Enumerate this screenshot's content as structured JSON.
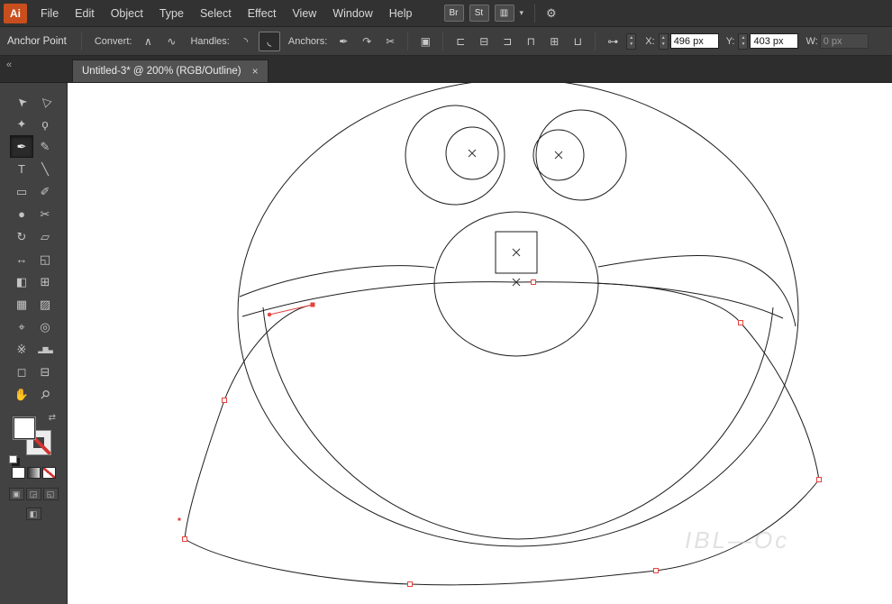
{
  "colors": {
    "selection": "#e5433e",
    "app_icon_bg": "#c94e1d",
    "ui_dark": "#323232",
    "canvas_bg": "#ffffff"
  },
  "menubar": {
    "app_icon": "Ai",
    "menus": [
      "File",
      "Edit",
      "Object",
      "Type",
      "Select",
      "Effect",
      "View",
      "Window",
      "Help"
    ],
    "bridge": "Br",
    "stock": "St",
    "workspace_glyph": "▥",
    "caret_glyph": "▾",
    "live_glyph": "⚙"
  },
  "controlbar": {
    "context": "Anchor Point",
    "convert_label": "Convert:",
    "convert_corner_glyph": "∧",
    "convert_smooth_glyph": "∿",
    "handles_label": "Handles:",
    "handles_show_glyph": "◝",
    "handles_hide_glyph": "◟",
    "anchors_label": "Anchors:",
    "anchors_remove_glyph": "✒",
    "anchors_connect_glyph": "↷",
    "anchors_cut_glyph": "✂",
    "isolate_glyph": "▣",
    "align_left_glyph": "⊏",
    "align_center_glyph": "⊟",
    "align_right_glyph": "⊐",
    "align_top_glyph": "⊓",
    "align_middle_glyph": "⊞",
    "align_bottom_glyph": "⊔",
    "point_glyph": "⊶",
    "stepper_up": "▲",
    "stepper_down": "▼",
    "x_label": "X:",
    "x_value": "496 px",
    "y_label": "Y:",
    "y_value": "403 px",
    "w_label": "W:",
    "w_value": "0 px"
  },
  "tabstrip": {
    "collapse_glyph": "«",
    "tab_title": "Untitled-3* @ 200% (RGB/Outline)",
    "close_glyph": "×"
  },
  "toolbar": {
    "tools": [
      {
        "name": "selection-tool",
        "glyph": "➤"
      },
      {
        "name": "direct-selection-tool",
        "glyph": "▷"
      },
      {
        "name": "magic-wand-tool",
        "glyph": "✦"
      },
      {
        "name": "lasso-tool",
        "glyph": "ϙ"
      },
      {
        "name": "pen-tool",
        "glyph": "✒"
      },
      {
        "name": "pencil-tool",
        "glyph": "✎"
      },
      {
        "name": "type-tool",
        "glyph": "T"
      },
      {
        "name": "line-segment-tool",
        "glyph": "╲"
      },
      {
        "name": "rectangle-tool",
        "glyph": "▭"
      },
      {
        "name": "paintbrush-tool",
        "glyph": "✐"
      },
      {
        "name": "blob-brush-tool",
        "glyph": "●"
      },
      {
        "name": "scissors-tool",
        "glyph": "✂"
      },
      {
        "name": "rotate-tool",
        "glyph": "↻"
      },
      {
        "name": "scale-tool",
        "glyph": "▱"
      },
      {
        "name": "width-tool",
        "glyph": "↔"
      },
      {
        "name": "free-transform-tool",
        "glyph": "◱"
      },
      {
        "name": "shape-builder-tool",
        "glyph": "◧"
      },
      {
        "name": "perspective-grid-tool",
        "glyph": "⊞"
      },
      {
        "name": "mesh-tool",
        "glyph": "▦"
      },
      {
        "name": "gradient-tool",
        "glyph": "▨"
      },
      {
        "name": "eyedropper-tool",
        "glyph": "⌖"
      },
      {
        "name": "blend-tool",
        "glyph": "◎"
      },
      {
        "name": "symbol-sprayer-tool",
        "glyph": "※"
      },
      {
        "name": "column-graph-tool",
        "glyph": "▂▆▃"
      },
      {
        "name": "artboard-tool",
        "glyph": "◻"
      },
      {
        "name": "slice-tool",
        "glyph": "⊟"
      },
      {
        "name": "hand-tool",
        "glyph": "✋"
      },
      {
        "name": "zoom-tool",
        "glyph": "⚲"
      }
    ],
    "swap_glyph": "⇄",
    "draw_mode_normal_glyph": "▣",
    "draw_mode_behind_glyph": "◲",
    "draw_mode_inside_glyph": "◱",
    "screen_mode_glyph": "◧"
  },
  "canvas": {
    "watermark": "IBL—Oc"
  }
}
